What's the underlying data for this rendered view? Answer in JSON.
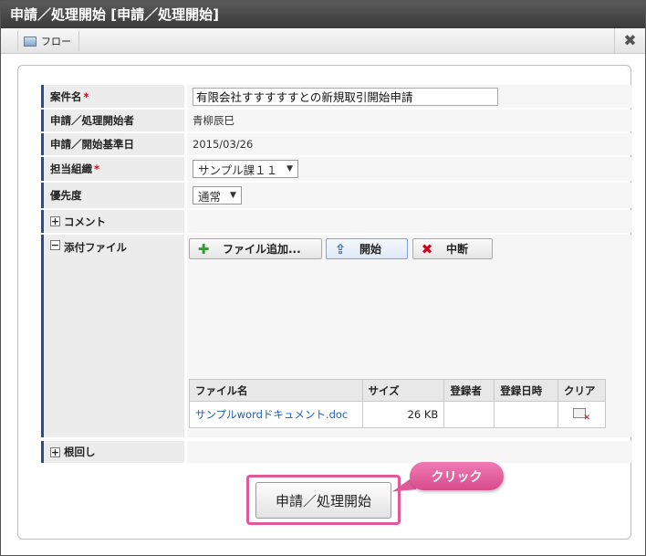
{
  "window": {
    "title": "申請／処理開始 [申請／処理開始]"
  },
  "toolbar": {
    "flow_tab_label": "フロー",
    "close_icon": "close-icon"
  },
  "form": {
    "subject": {
      "label": "案件名",
      "required_mark": "*",
      "value": "有限会社すすすすすとの新規取引開始申請"
    },
    "applicant": {
      "label": "申請／処理開始者",
      "value": "青柳辰巳"
    },
    "base_date": {
      "label": "申請／開始基準日",
      "value": "2015/03/26"
    },
    "org": {
      "label": "担当組織",
      "required_mark": "*",
      "selected": "サンプル課１１"
    },
    "priority": {
      "label": "優先度",
      "selected": "通常"
    },
    "comment": {
      "label": "コメント",
      "toggle": "+"
    },
    "attachments": {
      "label": "添付ファイル",
      "toggle": "−",
      "add_button": "ファイル追加...",
      "start_button": "開始",
      "stop_button": "中断",
      "columns": [
        "ファイル名",
        "サイズ",
        "登録者",
        "登録日時",
        "クリア"
      ],
      "rows": [
        {
          "name": "サンプルwordドキュメント.doc",
          "size": "26 KB",
          "registrant": "",
          "registered_at": ""
        }
      ]
    },
    "nemawashi": {
      "label": "根回し",
      "toggle": "+"
    }
  },
  "submit": {
    "label": "申請／処理開始",
    "callout": "クリック",
    "highlight_color": "#e05a9a"
  },
  "colors": {
    "title_bar": "#3a3a3a",
    "label_accent": "#2b4c8c",
    "required": "#d0021b",
    "link": "#1f5fbf"
  }
}
